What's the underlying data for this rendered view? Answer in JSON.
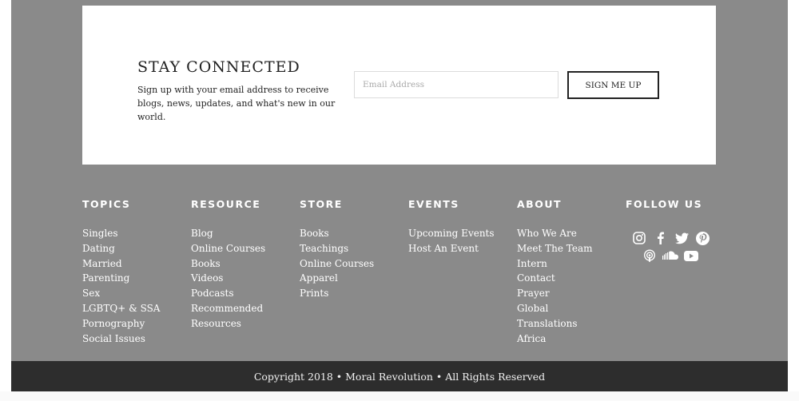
{
  "newsletter": {
    "heading": "STAY CONNECTED",
    "description": "Sign up with your email address to receive blogs, news, updates, and what's new in our world.",
    "email_placeholder": "Email Address",
    "email_value": "",
    "button_label": "SIGN ME UP"
  },
  "footer": {
    "columns": [
      {
        "title": "TOPICS",
        "items": [
          "Singles",
          "Dating",
          "Married",
          "Parenting",
          "Sex",
          "LGBTQ+ & SSA",
          "Pornography",
          "Social Issues"
        ]
      },
      {
        "title": "RESOURCE",
        "items": [
          "Blog",
          "Online Courses",
          "Books",
          "Videos",
          "Podcasts",
          "Recommended",
          "Resources"
        ]
      },
      {
        "title": "STORE",
        "items": [
          "Books",
          "Teachings",
          "Online Courses",
          "Apparel",
          "Prints"
        ]
      },
      {
        "title": "EVENTS",
        "items": [
          "Upcoming Events",
          "Host An Event"
        ]
      },
      {
        "title": "ABOUT",
        "items": [
          "Who We Are",
          "Meet The Team",
          "Intern",
          "Contact",
          "Prayer",
          "Global",
          "Translations",
          "Africa"
        ]
      }
    ],
    "follow": {
      "title": "FOLLOW US",
      "icons_row1": [
        "instagram-icon",
        "facebook-icon",
        "twitter-icon",
        "pinterest-icon"
      ],
      "icons_row2": [
        "podcast-icon",
        "soundcloud-icon",
        "youtube-icon"
      ]
    },
    "copyright": "Copyright 2018 • Moral Revolution • All Rights Reserved"
  },
  "colors": {
    "footer_bg": "#8a8a8a",
    "copyright_bg": "#2d2d2d",
    "text_light": "#ffffff",
    "text_dark": "#222222"
  }
}
